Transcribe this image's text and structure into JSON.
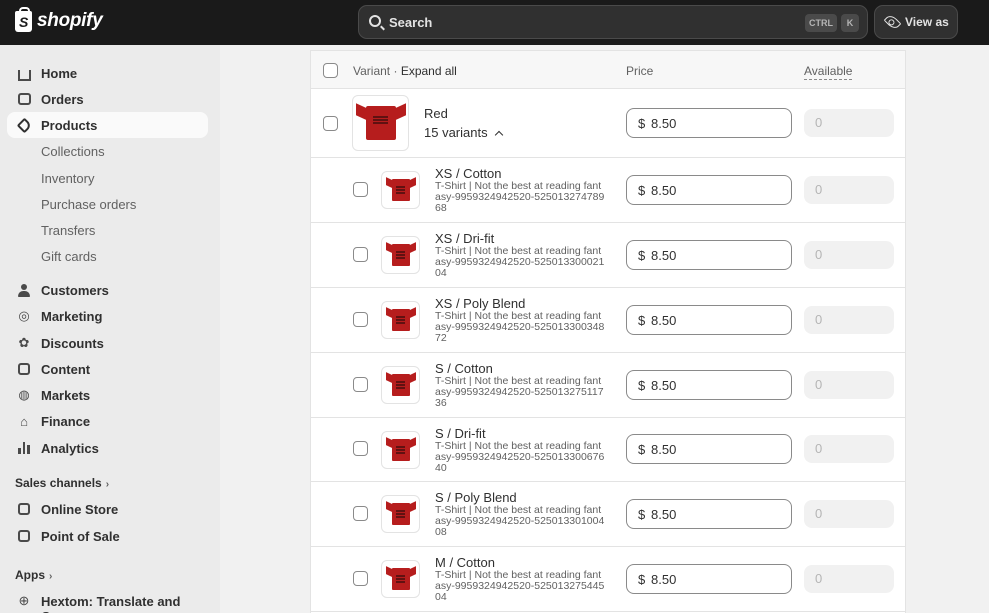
{
  "topbar": {
    "logo_text": "shopify",
    "search_placeholder": "Search",
    "kbd_ctrl": "CTRL",
    "kbd_k": "K",
    "view_as": "View as"
  },
  "sidebar": {
    "items": [
      {
        "label": "Home"
      },
      {
        "label": "Orders"
      },
      {
        "label": "Products"
      },
      {
        "label": "Collections"
      },
      {
        "label": "Inventory"
      },
      {
        "label": "Purchase orders"
      },
      {
        "label": "Transfers"
      },
      {
        "label": "Gift cards"
      },
      {
        "label": "Customers"
      },
      {
        "label": "Marketing"
      },
      {
        "label": "Discounts"
      },
      {
        "label": "Content"
      },
      {
        "label": "Markets"
      },
      {
        "label": "Finance"
      },
      {
        "label": "Analytics"
      }
    ],
    "sales_channels_title": "Sales channels",
    "channels": [
      {
        "label": "Online Store"
      },
      {
        "label": "Point of Sale"
      }
    ],
    "apps_title": "Apps",
    "apps": [
      {
        "label": "Hextom: Translate and Cu..."
      }
    ]
  },
  "table": {
    "header_variant": "Variant",
    "header_sep": " · ",
    "header_expand": "Expand all",
    "header_price": "Price",
    "header_available": "Available",
    "group": {
      "name": "Red",
      "count": "15 variants",
      "price_currency": "$",
      "price": "8.50",
      "available": "0"
    },
    "variants": [
      {
        "name": "XS / Cotton",
        "sku": "T-Shirt | Not the best at reading fantasy-9959324942520-52501327478968",
        "currency": "$",
        "price": "8.50",
        "available": "0"
      },
      {
        "name": "XS / Dri-fit",
        "sku": "T-Shirt | Not the best at reading fantasy-9959324942520-52501330002104",
        "currency": "$",
        "price": "8.50",
        "available": "0"
      },
      {
        "name": "XS / Poly Blend",
        "sku": "T-Shirt | Not the best at reading fantasy-9959324942520-52501330034872",
        "currency": "$",
        "price": "8.50",
        "available": "0"
      },
      {
        "name": "S / Cotton",
        "sku": "T-Shirt | Not the best at reading fantasy-9959324942520-52501327511736",
        "currency": "$",
        "price": "8.50",
        "available": "0"
      },
      {
        "name": "S / Dri-fit",
        "sku": "T-Shirt | Not the best at reading fantasy-9959324942520-52501330067640",
        "currency": "$",
        "price": "8.50",
        "available": "0"
      },
      {
        "name": "S / Poly Blend",
        "sku": "T-Shirt | Not the best at reading fantasy-9959324942520-52501330100408",
        "currency": "$",
        "price": "8.50",
        "available": "0"
      },
      {
        "name": "M / Cotton",
        "sku": "T-Shirt | Not the best at reading fantasy-9959324942520-52501327544504",
        "currency": "$",
        "price": "8.50",
        "available": "0"
      }
    ]
  }
}
